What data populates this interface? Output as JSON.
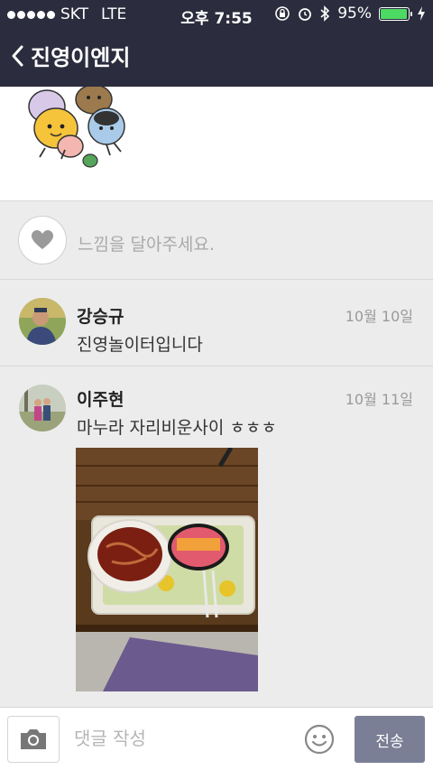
{
  "status_bar": {
    "carrier": "SKT",
    "network": "LTE",
    "time": "오후 7:55",
    "battery": "95%",
    "battery_level": 0.95
  },
  "nav": {
    "title": "진영이엔지"
  },
  "like": {
    "prompt": "느낌을 달아주세요."
  },
  "comments": [
    {
      "name": "강승규",
      "date": "10월 10일",
      "text": "진영놀이터입니다"
    },
    {
      "name": "이주현",
      "date": "10월 11일",
      "text": "마누라 자리비운사이 ㅎㅎㅎ"
    }
  ],
  "input_bar": {
    "placeholder": "댓글 작성",
    "send_label": "전송"
  },
  "colors": {
    "header": "#2b2c3d",
    "send_button": "#7a7f95",
    "battery": "#4cd964"
  }
}
